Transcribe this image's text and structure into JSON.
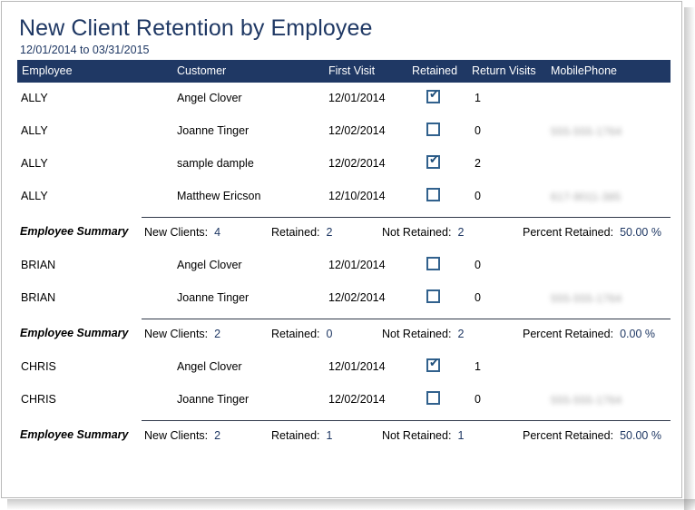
{
  "report": {
    "title": "New Client Retention by Employee",
    "date_range": "12/01/2014 to 03/31/2015",
    "accent_color": "#1f3864",
    "header_text_color": "#ffffff",
    "checkbox_color": "#31618d"
  },
  "columns": [
    {
      "key": "employee",
      "label": "Employee"
    },
    {
      "key": "customer",
      "label": "Customer"
    },
    {
      "key": "firstvisit",
      "label": "First Visit"
    },
    {
      "key": "retained",
      "label": "Retained"
    },
    {
      "key": "returns",
      "label": "Return Visits"
    },
    {
      "key": "phone",
      "label": "MobilePhone"
    }
  ],
  "summary_labels": {
    "group_label": "Employee Summary",
    "new_clients": "New Clients:",
    "retained": "Retained:",
    "not_retained": "Not Retained:",
    "percent_retained": "Percent Retained:"
  },
  "groups": [
    {
      "employee": "ALLY",
      "rows": [
        {
          "employee": "ALLY",
          "customer": "Angel Clover",
          "firstvisit": "12/01/2014",
          "retained": true,
          "returns": "1",
          "phone": ""
        },
        {
          "employee": "ALLY",
          "customer": "Joanne Tinger",
          "firstvisit": "12/02/2014",
          "retained": false,
          "returns": "0",
          "phone": "555-555-1764"
        },
        {
          "employee": "ALLY",
          "customer": "sample dample",
          "firstvisit": "12/02/2014",
          "retained": true,
          "returns": "2",
          "phone": ""
        },
        {
          "employee": "ALLY",
          "customer": "Matthew Ericson",
          "firstvisit": "12/10/2014",
          "retained": false,
          "returns": "0",
          "phone": "617-9011-385"
        }
      ],
      "summary": {
        "new_clients": "4",
        "retained": "2",
        "not_retained": "2",
        "percent_retained": "50.00 %"
      }
    },
    {
      "employee": "BRIAN",
      "rows": [
        {
          "employee": "BRIAN",
          "customer": "Angel Clover",
          "firstvisit": "12/01/2014",
          "retained": false,
          "returns": "0",
          "phone": ""
        },
        {
          "employee": "BRIAN",
          "customer": "Joanne Tinger",
          "firstvisit": "12/02/2014",
          "retained": false,
          "returns": "0",
          "phone": "555-555-1764"
        }
      ],
      "summary": {
        "new_clients": "2",
        "retained": "0",
        "not_retained": "2",
        "percent_retained": "0.00 %"
      }
    },
    {
      "employee": "CHRIS",
      "rows": [
        {
          "employee": "CHRIS",
          "customer": "Angel Clover",
          "firstvisit": "12/01/2014",
          "retained": true,
          "returns": "1",
          "phone": ""
        },
        {
          "employee": "CHRIS",
          "customer": "Joanne Tinger",
          "firstvisit": "12/02/2014",
          "retained": false,
          "returns": "0",
          "phone": "555-555-1764"
        }
      ],
      "summary": {
        "new_clients": "2",
        "retained": "1",
        "not_retained": "1",
        "percent_retained": "50.00 %"
      }
    }
  ]
}
